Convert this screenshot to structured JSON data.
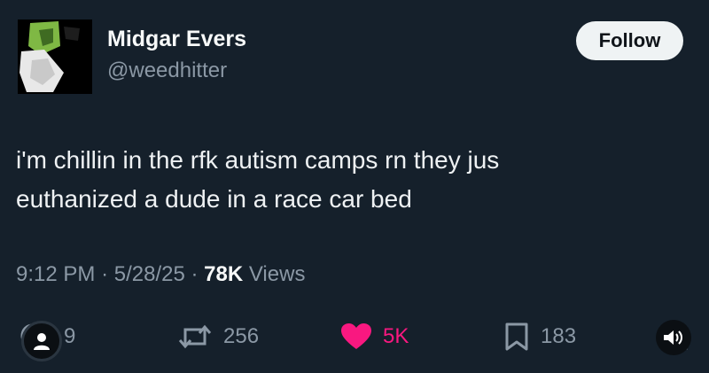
{
  "author": {
    "name": "Midgar Evers",
    "handle": "@weedhitter"
  },
  "follow_button": {
    "label": "Follow"
  },
  "tweet": {
    "text_line1": "i'm chillin in the rfk autism camps rn they jus",
    "text_line2": "euthanized a dude in a race car bed"
  },
  "meta": {
    "time": "9:12 PM",
    "separator": "·",
    "date": "5/28/25",
    "views_count": "78K",
    "views_label": "Views"
  },
  "actions": {
    "replies": "9",
    "reposts": "256",
    "likes": "5K",
    "bookmarks": "183"
  },
  "icons": {
    "reply": "reply-icon",
    "repost": "repost-icon",
    "like": "heart-icon",
    "bookmark": "bookmark-icon",
    "share": "share-icon",
    "sound": "speaker-icon"
  },
  "colors": {
    "background": "#15202b",
    "like_accent": "#f91880",
    "muted": "#8b98a5"
  }
}
